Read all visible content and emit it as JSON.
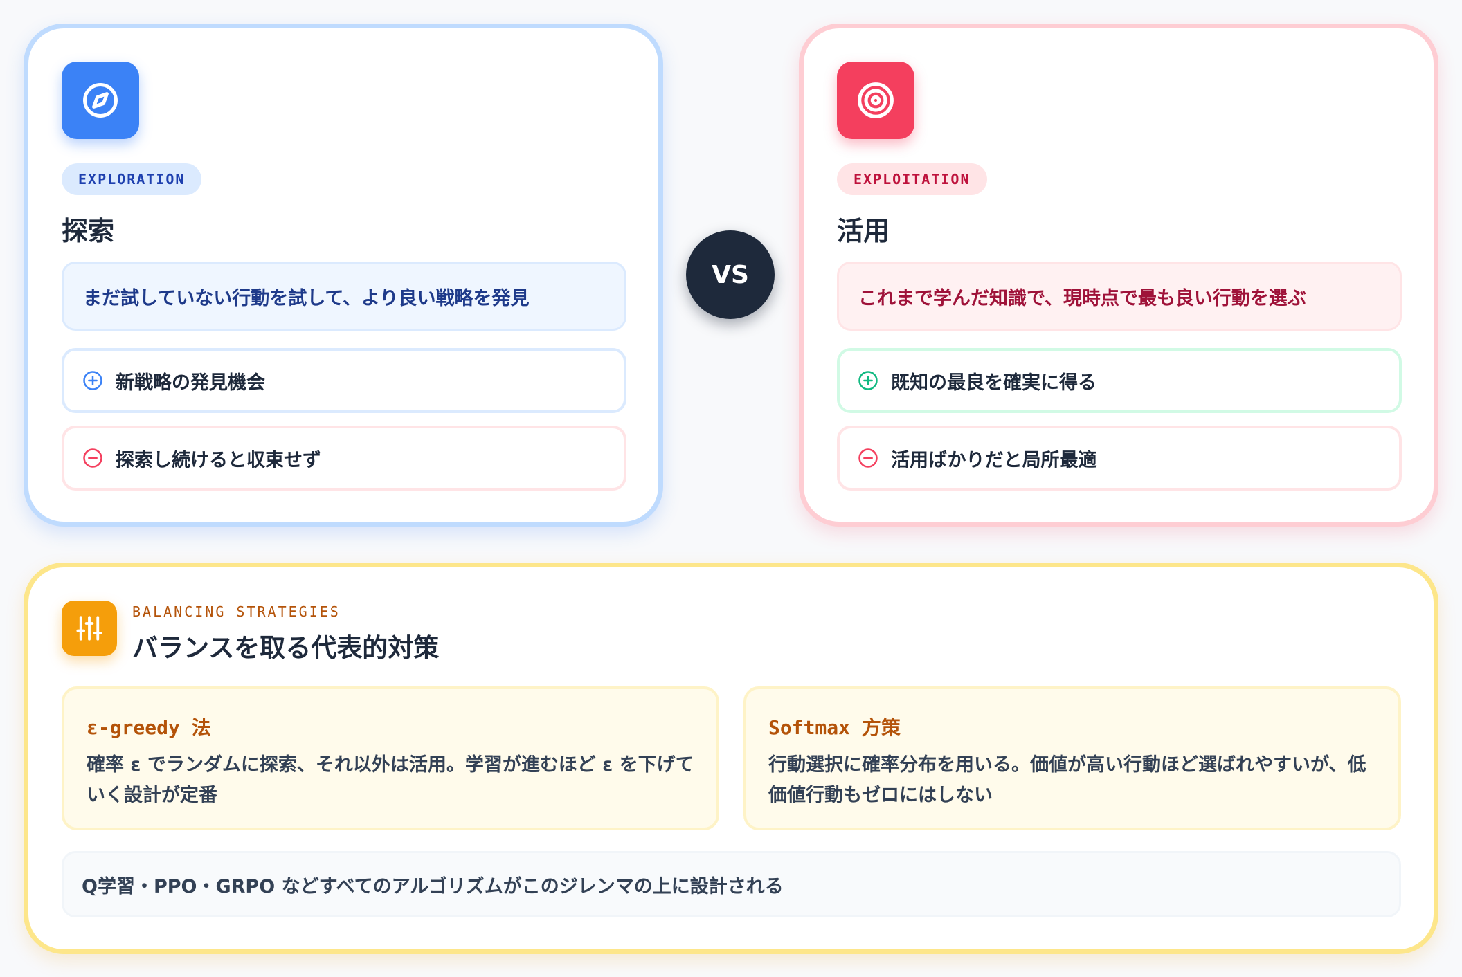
{
  "exploration": {
    "tag": "EXPLORATION",
    "title": "探索",
    "description": "まだ試していない行動を試して、より良い戦略を発見",
    "pro": "新戦略の発見機会",
    "con": "探索し続けると収束せず"
  },
  "vs_label": "VS",
  "exploitation": {
    "tag": "EXPLOITATION",
    "title": "活用",
    "description": "これまで学んだ知識で、現時点で最も良い行動を選ぶ",
    "pro": "既知の最良を確実に得る",
    "con": "活用ばかりだと局所最適"
  },
  "balancing": {
    "eyebrow": "BALANCING STRATEGIES",
    "title": "バランスを取る代表的対策",
    "strategies": [
      {
        "name": "ε-greedy 法",
        "description": "確率 ε でランダムに探索、それ以外は活用。学習が進むほど ε を下げていく設計が定番"
      },
      {
        "name": "Softmax 方策",
        "description": "行動選択に確率分布を用いる。価値が高い行動ほど選ばれやすいが、低価値行動もゼロにはしない"
      }
    ],
    "footer": "Q学習・PPO・GRPO などすべてのアルゴリズムがこのジレンマの上に設計される"
  },
  "colors": {
    "exploration_accent": "#3b82f6",
    "exploitation_accent": "#f43f5e",
    "balance_accent": "#f59e0b",
    "pro_green": "#10b981",
    "con_red": "#f43f5e"
  },
  "icons": {
    "exploration": "compass-icon",
    "exploitation": "target-icon",
    "balancing": "sliders-icon",
    "pro": "plus-circle-icon",
    "con": "minus-circle-icon"
  }
}
